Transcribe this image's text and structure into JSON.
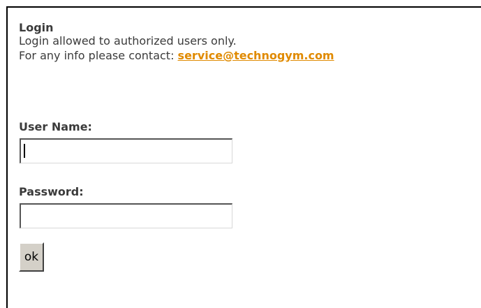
{
  "login": {
    "title": "Login",
    "notice": "Login allowed to authorized users only.",
    "contact_prefix": "For any info please contact: ",
    "contact_email": "service@technogym.com"
  },
  "form": {
    "username_label": "User Name:",
    "username_value": "",
    "password_label": "Password:",
    "password_value": "",
    "submit_label": "ok"
  }
}
